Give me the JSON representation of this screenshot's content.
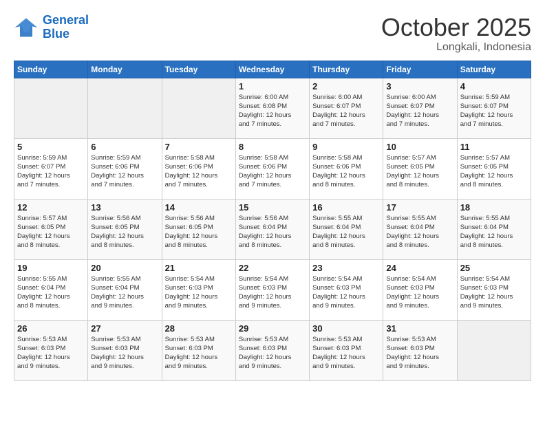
{
  "header": {
    "logo_line1": "General",
    "logo_line2": "Blue",
    "month": "October 2025",
    "location": "Longkali, Indonesia"
  },
  "weekdays": [
    "Sunday",
    "Monday",
    "Tuesday",
    "Wednesday",
    "Thursday",
    "Friday",
    "Saturday"
  ],
  "weeks": [
    [
      {
        "day": "",
        "info": ""
      },
      {
        "day": "",
        "info": ""
      },
      {
        "day": "",
        "info": ""
      },
      {
        "day": "1",
        "info": "Sunrise: 6:00 AM\nSunset: 6:08 PM\nDaylight: 12 hours\nand 7 minutes."
      },
      {
        "day": "2",
        "info": "Sunrise: 6:00 AM\nSunset: 6:07 PM\nDaylight: 12 hours\nand 7 minutes."
      },
      {
        "day": "3",
        "info": "Sunrise: 6:00 AM\nSunset: 6:07 PM\nDaylight: 12 hours\nand 7 minutes."
      },
      {
        "day": "4",
        "info": "Sunrise: 5:59 AM\nSunset: 6:07 PM\nDaylight: 12 hours\nand 7 minutes."
      }
    ],
    [
      {
        "day": "5",
        "info": "Sunrise: 5:59 AM\nSunset: 6:07 PM\nDaylight: 12 hours\nand 7 minutes."
      },
      {
        "day": "6",
        "info": "Sunrise: 5:59 AM\nSunset: 6:06 PM\nDaylight: 12 hours\nand 7 minutes."
      },
      {
        "day": "7",
        "info": "Sunrise: 5:58 AM\nSunset: 6:06 PM\nDaylight: 12 hours\nand 7 minutes."
      },
      {
        "day": "8",
        "info": "Sunrise: 5:58 AM\nSunset: 6:06 PM\nDaylight: 12 hours\nand 7 minutes."
      },
      {
        "day": "9",
        "info": "Sunrise: 5:58 AM\nSunset: 6:06 PM\nDaylight: 12 hours\nand 8 minutes."
      },
      {
        "day": "10",
        "info": "Sunrise: 5:57 AM\nSunset: 6:05 PM\nDaylight: 12 hours\nand 8 minutes."
      },
      {
        "day": "11",
        "info": "Sunrise: 5:57 AM\nSunset: 6:05 PM\nDaylight: 12 hours\nand 8 minutes."
      }
    ],
    [
      {
        "day": "12",
        "info": "Sunrise: 5:57 AM\nSunset: 6:05 PM\nDaylight: 12 hours\nand 8 minutes."
      },
      {
        "day": "13",
        "info": "Sunrise: 5:56 AM\nSunset: 6:05 PM\nDaylight: 12 hours\nand 8 minutes."
      },
      {
        "day": "14",
        "info": "Sunrise: 5:56 AM\nSunset: 6:05 PM\nDaylight: 12 hours\nand 8 minutes."
      },
      {
        "day": "15",
        "info": "Sunrise: 5:56 AM\nSunset: 6:04 PM\nDaylight: 12 hours\nand 8 minutes."
      },
      {
        "day": "16",
        "info": "Sunrise: 5:55 AM\nSunset: 6:04 PM\nDaylight: 12 hours\nand 8 minutes."
      },
      {
        "day": "17",
        "info": "Sunrise: 5:55 AM\nSunset: 6:04 PM\nDaylight: 12 hours\nand 8 minutes."
      },
      {
        "day": "18",
        "info": "Sunrise: 5:55 AM\nSunset: 6:04 PM\nDaylight: 12 hours\nand 8 minutes."
      }
    ],
    [
      {
        "day": "19",
        "info": "Sunrise: 5:55 AM\nSunset: 6:04 PM\nDaylight: 12 hours\nand 8 minutes."
      },
      {
        "day": "20",
        "info": "Sunrise: 5:55 AM\nSunset: 6:04 PM\nDaylight: 12 hours\nand 9 minutes."
      },
      {
        "day": "21",
        "info": "Sunrise: 5:54 AM\nSunset: 6:03 PM\nDaylight: 12 hours\nand 9 minutes."
      },
      {
        "day": "22",
        "info": "Sunrise: 5:54 AM\nSunset: 6:03 PM\nDaylight: 12 hours\nand 9 minutes."
      },
      {
        "day": "23",
        "info": "Sunrise: 5:54 AM\nSunset: 6:03 PM\nDaylight: 12 hours\nand 9 minutes."
      },
      {
        "day": "24",
        "info": "Sunrise: 5:54 AM\nSunset: 6:03 PM\nDaylight: 12 hours\nand 9 minutes."
      },
      {
        "day": "25",
        "info": "Sunrise: 5:54 AM\nSunset: 6:03 PM\nDaylight: 12 hours\nand 9 minutes."
      }
    ],
    [
      {
        "day": "26",
        "info": "Sunrise: 5:53 AM\nSunset: 6:03 PM\nDaylight: 12 hours\nand 9 minutes."
      },
      {
        "day": "27",
        "info": "Sunrise: 5:53 AM\nSunset: 6:03 PM\nDaylight: 12 hours\nand 9 minutes."
      },
      {
        "day": "28",
        "info": "Sunrise: 5:53 AM\nSunset: 6:03 PM\nDaylight: 12 hours\nand 9 minutes."
      },
      {
        "day": "29",
        "info": "Sunrise: 5:53 AM\nSunset: 6:03 PM\nDaylight: 12 hours\nand 9 minutes."
      },
      {
        "day": "30",
        "info": "Sunrise: 5:53 AM\nSunset: 6:03 PM\nDaylight: 12 hours\nand 9 minutes."
      },
      {
        "day": "31",
        "info": "Sunrise: 5:53 AM\nSunset: 6:03 PM\nDaylight: 12 hours\nand 9 minutes."
      },
      {
        "day": "",
        "info": ""
      }
    ]
  ]
}
